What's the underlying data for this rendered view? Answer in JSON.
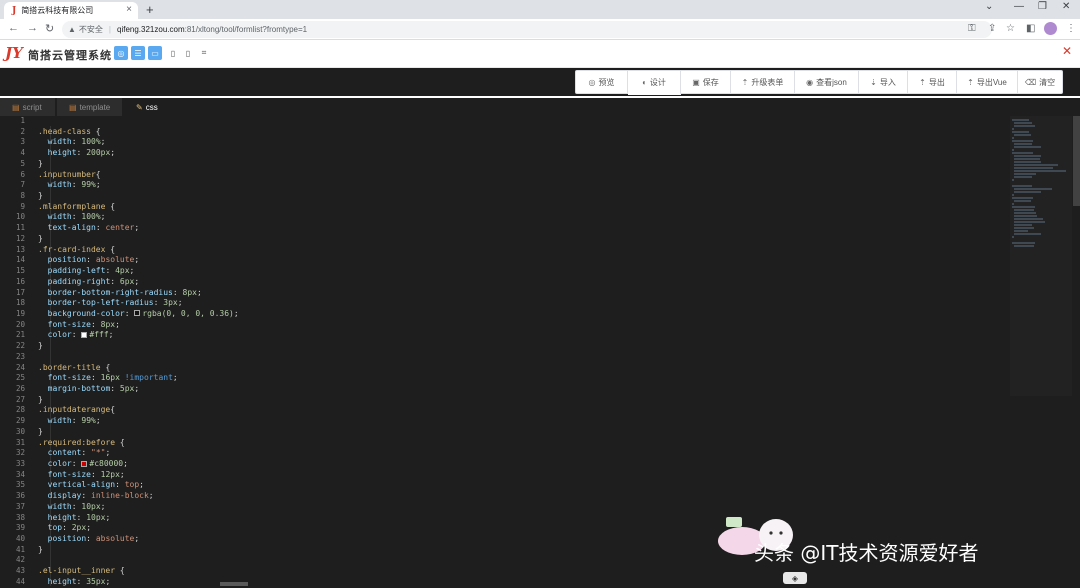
{
  "browser": {
    "tab_title": "简搭云科技有限公司",
    "tab_favicon": "jd-logo-icon",
    "url_warning": "不安全",
    "url_host": "qifeng.321zou.com",
    "url_path": ":81/xltong/tool/formlist?fromtype=1"
  },
  "app": {
    "logo_glyph": "JY",
    "name": "简搭云管理系统"
  },
  "toolbar": {
    "items": [
      {
        "label": "预览",
        "icon": "preview-icon"
      },
      {
        "label": "设计",
        "icon": "design-icon"
      },
      {
        "label": "保存",
        "icon": "save-icon"
      },
      {
        "label": "升级表单",
        "icon": "upgrade-icon"
      },
      {
        "label": "查看json",
        "icon": "view-json-icon"
      },
      {
        "label": "导入",
        "icon": "import-icon"
      },
      {
        "label": "导出",
        "icon": "export-icon"
      },
      {
        "label": "导出Vue",
        "icon": "export-vue-icon"
      },
      {
        "label": "清空",
        "icon": "clear-icon"
      }
    ]
  },
  "editor": {
    "tabs": [
      {
        "label": "script"
      },
      {
        "label": "template"
      },
      {
        "label": "css"
      }
    ],
    "active_tab": "css",
    "lines": [
      "",
      ".head-class {",
      "  width: 100%;",
      "  height: 200px;",
      "}",
      ".inputnumber{",
      "  width: 99%;",
      "}",
      ".mlanformplane {",
      "  width: 100%;",
      "  text-align: center;",
      "}",
      ".fr-card-index {",
      "  position: absolute;",
      "  padding-left: 4px;",
      "  padding-right: 6px;",
      "  border-bottom-right-radius: 8px;",
      "  border-top-left-radius: 3px;",
      "  background-color: rgba(0, 0, 0, 0.36);",
      "  font-size: 8px;",
      "  color: #fff;",
      "}",
      "",
      ".border-title {",
      "  font-size: 16px !important;",
      "  margin-bottom: 5px;",
      "}",
      ".inputdaterange{",
      "  width: 99%;",
      "}",
      ".required:before {",
      "  content: \"*\";",
      "  color: #c80000;",
      "  font-size: 12px;",
      "  vertical-align: top;",
      "  display: inline-block;",
      "  width: 10px;",
      "  height: 10px;",
      "  top: 2px;",
      "  position: absolute;",
      "}",
      "",
      ".el-input__inner {",
      "  height: 35px;"
    ]
  },
  "watermark": {
    "text": "头条 @IT技术资源爱好者"
  },
  "colors": {
    "editor_bg": "#1e1e1e",
    "accent": "#5aa9f0",
    "brand": "#d93a2b",
    "required_color": "#c80000"
  }
}
